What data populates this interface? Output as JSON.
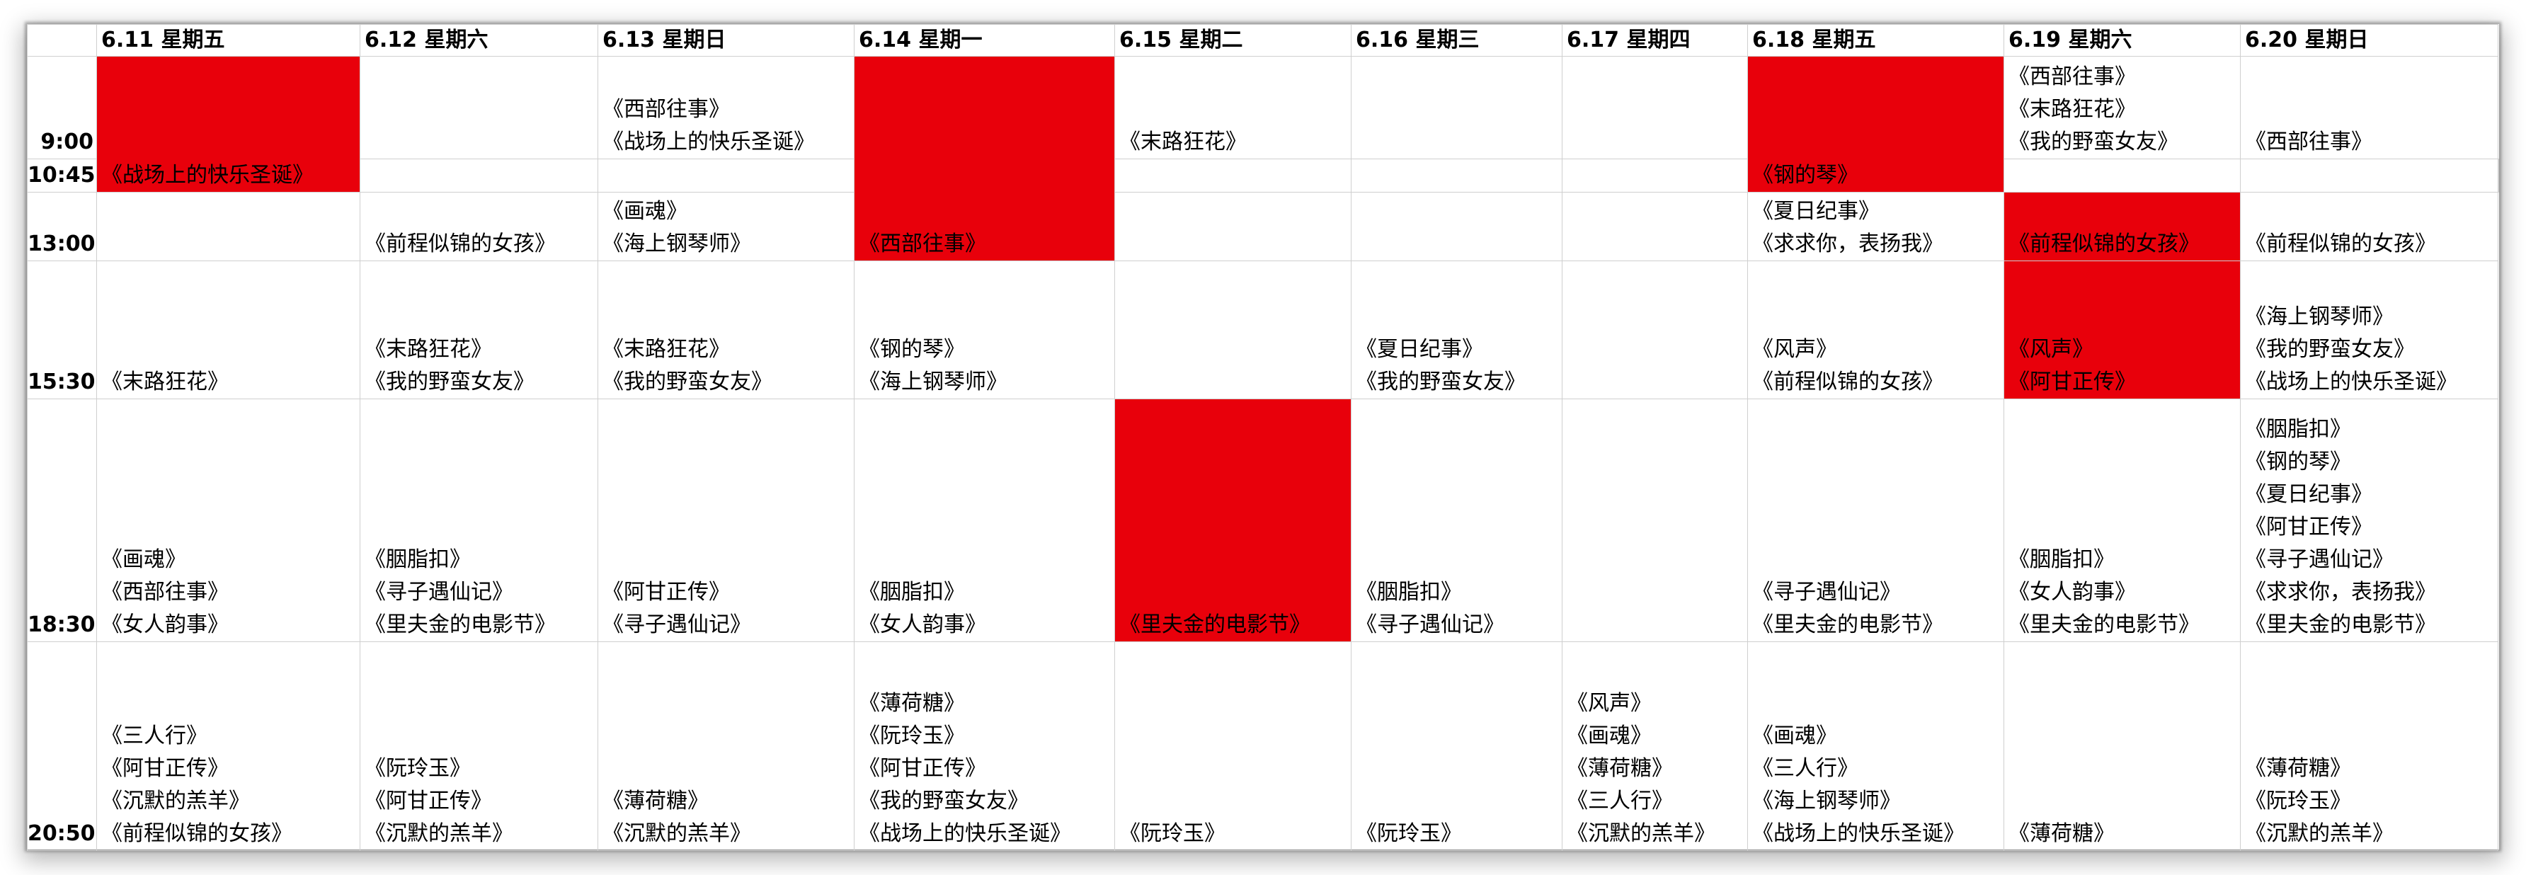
{
  "days": [
    "6.11 星期五",
    "6.12 星期六",
    "6.13 星期日",
    "6.14 星期一",
    "6.15 星期二",
    "6.16 星期三",
    "6.17 星期四",
    "6.18 星期五",
    "6.19 星期六",
    "6.20 星期日"
  ],
  "times": [
    "9:00",
    "10:45",
    "13:00",
    "15:30",
    "18:30",
    "20:50"
  ],
  "highlight_color": "#e8000b",
  "schedule": {
    "d0": {
      "s0900": [
        "《战场上的快乐圣诞》"
      ],
      "s1530": [
        "《末路狂花》"
      ],
      "s1830": [
        "《画魂》",
        "《西部往事》",
        "《女人韵事》"
      ],
      "s2050": [
        "《三人行》",
        "《阿甘正传》",
        "《沉默的羔羊》",
        "《前程似锦的女孩》"
      ]
    },
    "d1": {
      "s1300": [
        "《前程似锦的女孩》"
      ],
      "s1530": [
        "《末路狂花》",
        "《我的野蛮女友》"
      ],
      "s1830": [
        "《胭脂扣》",
        "《寻子遇仙记》",
        "《里夫金的电影节》"
      ],
      "s2050": [
        "《阮玲玉》",
        "《阿甘正传》",
        "《沉默的羔羊》"
      ]
    },
    "d2": {
      "s0900": [
        "《西部往事》",
        "《战场上的快乐圣诞》"
      ],
      "s1300": [
        "《画魂》",
        "《海上钢琴师》"
      ],
      "s1530": [
        "《末路狂花》",
        "《我的野蛮女友》"
      ],
      "s1830": [
        "《阿甘正传》",
        "《寻子遇仙记》"
      ],
      "s2050": [
        "《薄荷糖》",
        "《沉默的羔羊》"
      ]
    },
    "d3": {
      "s0900": [
        "《西部往事》"
      ],
      "s1530": [
        "《钢的琴》",
        "《海上钢琴师》"
      ],
      "s1830": [
        "《胭脂扣》",
        "《女人韵事》"
      ],
      "s2050": [
        "《薄荷糖》",
        "《阮玲玉》",
        "《阿甘正传》",
        "《我的野蛮女友》",
        "《战场上的快乐圣诞》"
      ]
    },
    "d4": {
      "s0900": [
        "《末路狂花》"
      ],
      "s1830": [
        "《里夫金的电影节》"
      ],
      "s2050": [
        "《阮玲玉》"
      ]
    },
    "d5": {
      "s1530": [
        "《夏日纪事》",
        "《我的野蛮女友》"
      ],
      "s1830": [
        "《胭脂扣》",
        "《寻子遇仙记》"
      ],
      "s2050": [
        "《阮玲玉》"
      ]
    },
    "d6": {
      "s2050": [
        "《风声》",
        "《画魂》",
        "《薄荷糖》",
        "《三人行》",
        "《沉默的羔羊》"
      ]
    },
    "d7": {
      "s0900": [
        "《钢的琴》"
      ],
      "s1300": [
        "《夏日纪事》",
        "《求求你，表扬我》"
      ],
      "s1530": [
        "《风声》",
        "《前程似锦的女孩》"
      ],
      "s1830": [
        "《寻子遇仙记》",
        "《里夫金的电影节》"
      ],
      "s2050": [
        "《画魂》",
        "《三人行》",
        "《海上钢琴师》",
        "《战场上的快乐圣诞》"
      ]
    },
    "d8": {
      "s0900": [
        "《西部往事》",
        "《末路狂花》",
        "《我的野蛮女友》"
      ],
      "s1300": [
        "《前程似锦的女孩》"
      ],
      "s1530": [
        "《风声》",
        "《阿甘正传》"
      ],
      "s1830": [
        "《胭脂扣》",
        "《女人韵事》",
        "《里夫金的电影节》"
      ],
      "s2050": [
        "《薄荷糖》"
      ]
    },
    "d9": {
      "s0900": [
        "《西部往事》"
      ],
      "s1300": [
        "《前程似锦的女孩》"
      ],
      "s1530": [
        "《海上钢琴师》",
        "《我的野蛮女友》",
        "《战场上的快乐圣诞》"
      ],
      "s1830": [
        "《胭脂扣》",
        "《钢的琴》",
        "《夏日纪事》",
        "《阿甘正传》",
        "《寻子遇仙记》",
        "《求求你，表扬我》",
        "《里夫金的电影节》"
      ],
      "s2050": [
        "《薄荷糖》",
        "《阮玲玉》",
        "《沉默的羔羊》"
      ]
    }
  }
}
